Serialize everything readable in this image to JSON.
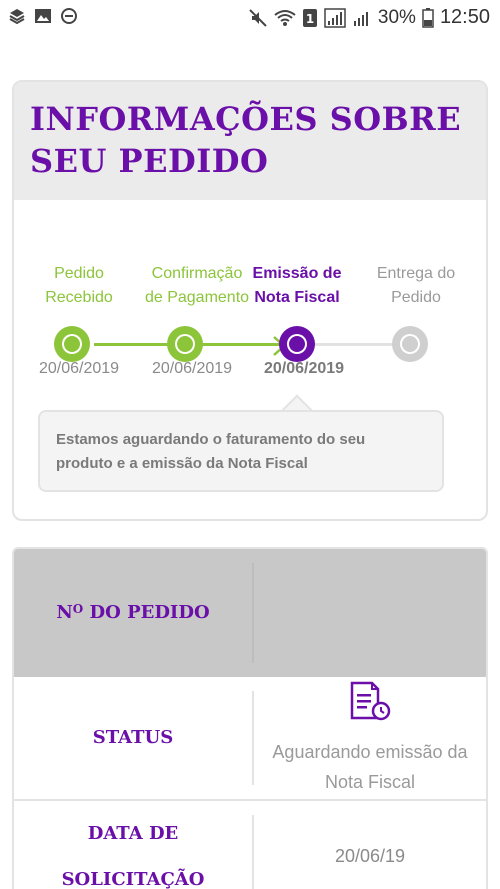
{
  "status_bar": {
    "left_icons": [
      "layers-icon",
      "image-icon",
      "do-not-disturb-icon"
    ],
    "right_icons": [
      "mute-icon",
      "wifi-icon",
      "sim-1-icon",
      "signal-1-icon",
      "signal-2-icon"
    ],
    "battery_percent": "30%",
    "time": "12:50"
  },
  "order_info": {
    "title": "INFORMAÇÕES SOBRE SEU PEDIDO",
    "steps": [
      {
        "label_line1": "Pedido",
        "label_line2": "Recebido",
        "date": "20/06/2019",
        "state": "done"
      },
      {
        "label_line1": "Confirmação",
        "label_line2": "de Pagamento",
        "date": "20/06/2019",
        "state": "done"
      },
      {
        "label_line1": "Emissão de",
        "label_line2": "Nota Fiscal",
        "date": "20/06/2019",
        "state": "current"
      },
      {
        "label_line1": "Entrega do",
        "label_line2": "Pedido",
        "date": "",
        "state": "pending"
      }
    ],
    "message": "Estamos aguardando o faturamento do seu produto e a emissão da Nota Fiscal"
  },
  "details": {
    "order_number_label_prefix": "N",
    "order_number_label_sup": "O",
    "order_number_label_suffix": " DO PEDIDO",
    "order_number_value": "",
    "status_label": "STATUS",
    "status_icon": "invoice-clock-icon",
    "status_value": "Aguardando emissão da Nota Fiscal",
    "request_date_label": "DATA DE SOLICITAÇÃO",
    "request_date_value": "20/06/19"
  },
  "colors": {
    "green": "#8cc43a",
    "purple": "#6a0fa8",
    "gray": "#cfcfcf"
  }
}
